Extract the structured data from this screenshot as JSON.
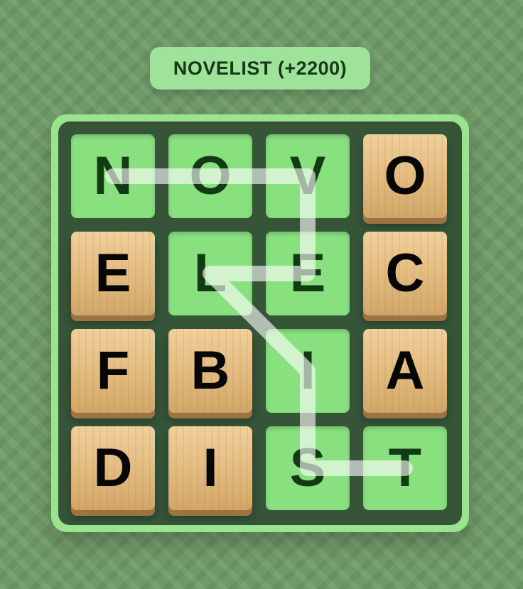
{
  "header": {
    "found_word": "NOVELIST (+2200)"
  },
  "board": {
    "rows": [
      [
        {
          "letter": "N",
          "selected": true
        },
        {
          "letter": "O",
          "selected": true
        },
        {
          "letter": "V",
          "selected": true
        },
        {
          "letter": "O",
          "selected": false
        }
      ],
      [
        {
          "letter": "E",
          "selected": false
        },
        {
          "letter": "L",
          "selected": true
        },
        {
          "letter": "E",
          "selected": true
        },
        {
          "letter": "C",
          "selected": false
        }
      ],
      [
        {
          "letter": "F",
          "selected": false
        },
        {
          "letter": "B",
          "selected": false
        },
        {
          "letter": "I",
          "selected": true
        },
        {
          "letter": "A",
          "selected": false
        }
      ],
      [
        {
          "letter": "D",
          "selected": false
        },
        {
          "letter": "I",
          "selected": false
        },
        {
          "letter": "S",
          "selected": true
        },
        {
          "letter": "T",
          "selected": true
        }
      ]
    ],
    "path_sequence": [
      [
        0,
        0
      ],
      [
        0,
        1
      ],
      [
        0,
        2
      ],
      [
        1,
        2
      ],
      [
        1,
        1
      ],
      [
        2,
        2
      ],
      [
        3,
        2
      ],
      [
        3,
        3
      ]
    ],
    "colors": {
      "selected_tile": "#89e07f",
      "wood_tile": "#e3bb80",
      "board_frame": "#9be48f",
      "board_inner": "#355438"
    }
  }
}
